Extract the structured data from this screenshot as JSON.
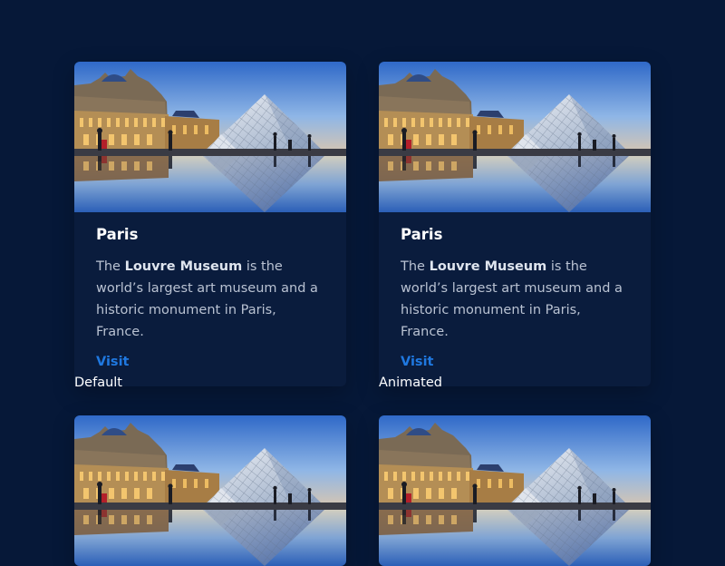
{
  "colors": {
    "background": "#061838",
    "card": "#0a1c3d",
    "link": "#1f78e0",
    "title": "#ffffff",
    "text": "#b9c2d2"
  },
  "cards": [
    {
      "image_alt": "Louvre pyramid at dusk",
      "title": "Paris",
      "text_before": "The ",
      "text_bold": "Louvre Museum",
      "text_after": " is the world’s largest art museum and a historic monument in Paris, France.",
      "link": "Visit",
      "caption": "Default"
    },
    {
      "image_alt": "Louvre pyramid at dusk",
      "title": "Paris",
      "text_before": "The ",
      "text_bold": "Louvre Museum",
      "text_after": " is the world’s largest art museum and a historic monument in Paris, France.",
      "link": "Visit",
      "caption": "Animated"
    },
    {
      "image_alt": "Louvre pyramid at dusk"
    },
    {
      "image_alt": "Louvre pyramid at dusk"
    }
  ]
}
